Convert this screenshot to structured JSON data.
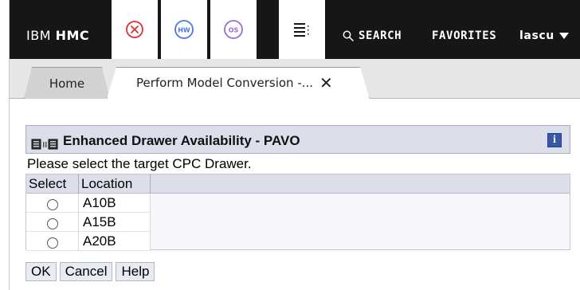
{
  "header": {
    "brand_prefix": "IBM",
    "brand_name": "HMC",
    "tools": [
      {
        "icon": "error-circle-icon",
        "color": "#e0303a"
      },
      {
        "icon": "hw-badge-icon",
        "label": "HW",
        "color": "#4a78e0"
      },
      {
        "icon": "os-badge-icon",
        "label": "OS",
        "color": "#9b6ad8"
      },
      {
        "icon": "task-list-icon"
      }
    ],
    "search_label": "SEARCH",
    "favorites_label": "FAVORITES",
    "user_label": "lascu"
  },
  "tabs": [
    {
      "label": "Home"
    },
    {
      "label": "Perform Model Conversion -..."
    }
  ],
  "panel": {
    "title": "Enhanced Drawer Availability - PAVO",
    "info_label": "i"
  },
  "prompt": "Please select the target CPC Drawer.",
  "table": {
    "columns": [
      "Select",
      "Location"
    ],
    "rows": [
      {
        "location": "A10B"
      },
      {
        "location": "A15B"
      },
      {
        "location": "A20B"
      }
    ]
  },
  "buttons": {
    "ok": "OK",
    "cancel": "Cancel",
    "help": "Help"
  }
}
